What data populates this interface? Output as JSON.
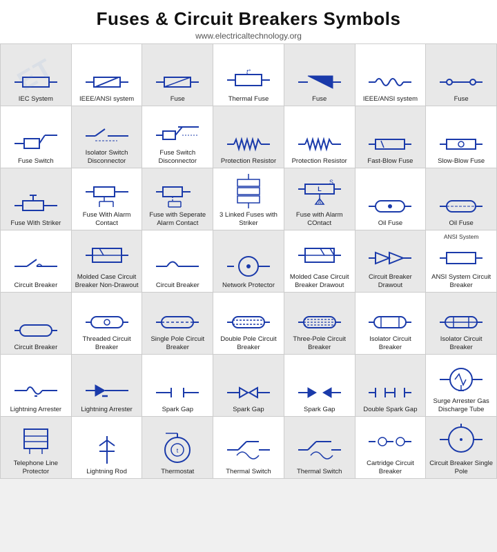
{
  "header": {
    "title": "Fuses & Circuit Breakers Symbols",
    "subtitle": "www.electricaltechnology.org"
  },
  "cells": [
    {
      "label": "IEC System",
      "sublabel": "",
      "system": "",
      "svg": "fuse_iec",
      "gray": true
    },
    {
      "label": "IEEE/ANSI system",
      "sublabel": "",
      "system": "",
      "svg": "fuse_ieee",
      "gray": false
    },
    {
      "label": "Fuse",
      "sublabel": "",
      "system": "",
      "svg": "fuse_rect_diag",
      "gray": true
    },
    {
      "label": "Thermal Fuse",
      "sublabel": "",
      "system": "",
      "svg": "thermal_fuse",
      "gray": false
    },
    {
      "label": "Fuse",
      "sublabel": "",
      "system": "",
      "svg": "fuse_triangle",
      "gray": true
    },
    {
      "label": "IEEE/ANSI system",
      "sublabel": "",
      "system": "",
      "svg": "fuse_wave",
      "gray": false
    },
    {
      "label": "Fuse",
      "sublabel": "",
      "system": "",
      "svg": "fuse_open",
      "gray": true
    },
    {
      "label": "Fuse Switch",
      "sublabel": "",
      "system": "",
      "svg": "fuse_switch",
      "gray": false
    },
    {
      "label": "Isolator Switch Disconnector",
      "sublabel": "",
      "system": "",
      "svg": "isolator_sw",
      "gray": true
    },
    {
      "label": "Fuse Switch Disconnector",
      "sublabel": "",
      "system": "",
      "svg": "fuse_sw_disc",
      "gray": false
    },
    {
      "label": "Protection Resistor",
      "sublabel": "",
      "system": "",
      "svg": "prot_resistor",
      "gray": true
    },
    {
      "label": "Protection Resistor",
      "sublabel": "",
      "system": "",
      "svg": "prot_resistor2",
      "gray": false
    },
    {
      "label": "Fast-Blow Fuse",
      "sublabel": "",
      "system": "",
      "svg": "fast_blow",
      "gray": true
    },
    {
      "label": "Slow-Blow Fuse",
      "sublabel": "",
      "system": "",
      "svg": "slow_blow",
      "gray": false
    },
    {
      "label": "Fuse With Striker",
      "sublabel": "",
      "system": "",
      "svg": "fuse_striker",
      "gray": true
    },
    {
      "label": "Fuse With Alarm Contact",
      "sublabel": "",
      "system": "",
      "svg": "fuse_alarm",
      "gray": false
    },
    {
      "label": "Fuse with Seperate Alarm Contact",
      "sublabel": "",
      "system": "",
      "svg": "fuse_sep_alarm",
      "gray": true
    },
    {
      "label": "3 Linked Fuses with Striker",
      "sublabel": "",
      "system": "",
      "svg": "three_linked",
      "gray": false
    },
    {
      "label": "Fuse with Alarm COntact",
      "sublabel": "",
      "system": "",
      "svg": "fuse_alarm2",
      "gray": true
    },
    {
      "label": "Oil Fuse",
      "sublabel": "",
      "system": "",
      "svg": "oil_fuse",
      "gray": false
    },
    {
      "label": "Oil Fuse",
      "sublabel": "",
      "system": "",
      "svg": "oil_fuse2",
      "gray": true
    },
    {
      "label": "Circuit Breaker",
      "sublabel": "",
      "system": "",
      "svg": "circuit_breaker",
      "gray": false
    },
    {
      "label": "Molded Case Circuit Breaker Non-Drawout",
      "sublabel": "",
      "system": "",
      "svg": "molded_case",
      "gray": true
    },
    {
      "label": "Circuit Breaker",
      "sublabel": "",
      "system": "",
      "svg": "circuit_breaker2",
      "gray": false
    },
    {
      "label": "Network Protector",
      "sublabel": "",
      "system": "",
      "svg": "network_prot",
      "gray": true
    },
    {
      "label": "Molded Case Circuit Breaker Drawout",
      "sublabel": "",
      "system": "",
      "svg": "molded_drawout",
      "gray": false
    },
    {
      "label": "Circuit Breaker Drawout",
      "sublabel": "",
      "system": "",
      "svg": "cb_drawout",
      "gray": true
    },
    {
      "label": "ANSI System\nCircuit Breaker",
      "sublabel": "",
      "system": "ANSI System",
      "svg": "cb_ansi",
      "gray": false
    },
    {
      "label": "Circuit Breaker",
      "sublabel": "",
      "system": "",
      "svg": "cb_capsule",
      "gray": true
    },
    {
      "label": "Threaded Circuit Breaker",
      "sublabel": "",
      "system": "",
      "svg": "threaded_cb",
      "gray": false
    },
    {
      "label": "Single Pole Circuit Breaker",
      "sublabel": "",
      "system": "",
      "svg": "single_pole_cb",
      "gray": true
    },
    {
      "label": "Double Pole Circuit Breaker",
      "sublabel": "",
      "system": "",
      "svg": "double_pole_cb",
      "gray": false
    },
    {
      "label": "Three-Pole Circuit Breaker",
      "sublabel": "",
      "system": "",
      "svg": "three_pole_cb",
      "gray": true
    },
    {
      "label": "Isolator Circuit Breaker",
      "sublabel": "",
      "system": "",
      "svg": "isolator_cb",
      "gray": false
    },
    {
      "label": "Isolator Circuit Breaker",
      "sublabel": "",
      "system": "",
      "svg": "isolator_cb2",
      "gray": true
    },
    {
      "label": "Lightning Arrester",
      "sublabel": "",
      "system": "",
      "svg": "lightning_arr",
      "gray": false
    },
    {
      "label": "Lightning Arrester",
      "sublabel": "",
      "system": "",
      "svg": "lightning_arr2",
      "gray": true
    },
    {
      "label": "Spark Gap",
      "sublabel": "",
      "system": "",
      "svg": "spark_gap",
      "gray": false
    },
    {
      "label": "Spark Gap",
      "sublabel": "",
      "system": "",
      "svg": "spark_gap2",
      "gray": true
    },
    {
      "label": "Spark Gap",
      "sublabel": "",
      "system": "",
      "svg": "spark_gap3",
      "gray": false
    },
    {
      "label": "Double Spark Gap",
      "sublabel": "",
      "system": "",
      "svg": "double_spark",
      "gray": true
    },
    {
      "label": "Surge Arrester Gas Discharge Tube",
      "sublabel": "",
      "system": "",
      "svg": "surge_arr",
      "gray": false
    },
    {
      "label": "Telephone Line Protector",
      "sublabel": "",
      "system": "",
      "svg": "tel_prot",
      "gray": true
    },
    {
      "label": "Lightning Rod",
      "sublabel": "",
      "system": "",
      "svg": "lightning_rod",
      "gray": false
    },
    {
      "label": "Thermostat",
      "sublabel": "",
      "system": "",
      "svg": "thermostat",
      "gray": true
    },
    {
      "label": "Thermal Switch",
      "sublabel": "",
      "system": "",
      "svg": "thermal_sw",
      "gray": false
    },
    {
      "label": "Thermal Switch",
      "sublabel": "",
      "system": "",
      "svg": "thermal_sw2",
      "gray": true
    },
    {
      "label": "Cartridge Circuit Breaker",
      "sublabel": "",
      "system": "",
      "svg": "cartridge_cb",
      "gray": false
    },
    {
      "label": "Circuit Breaker Single Pole",
      "sublabel": "",
      "system": "",
      "svg": "cb_single_pole",
      "gray": true
    }
  ]
}
